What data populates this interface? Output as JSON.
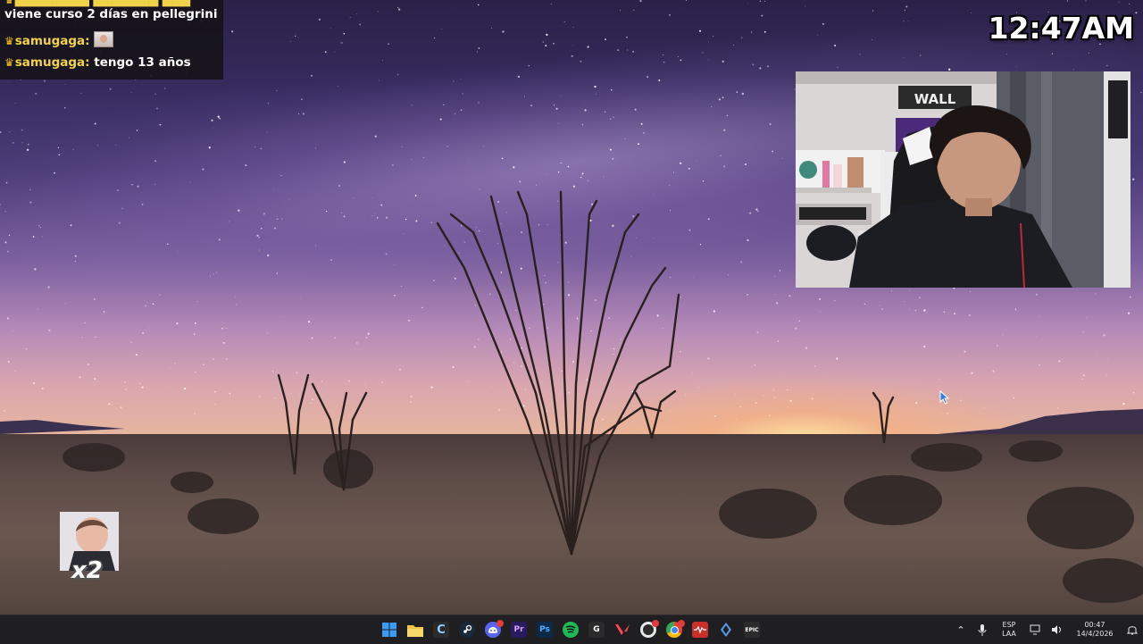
{
  "chat": {
    "messages": [
      {
        "user": "",
        "text": "viene curso 2 días en pellegrini"
      },
      {
        "user": "samugaga:",
        "text": "",
        "emote": "baby-emote"
      },
      {
        "user": "samugaga:",
        "text": "tengo 13 años"
      }
    ]
  },
  "clock": {
    "time": "12:47AM"
  },
  "baby_overlay": {
    "multiplier": "x2"
  },
  "taskbar": {
    "apps": [
      {
        "name": "start",
        "icon": "windows-start-icon",
        "label": "",
        "color": "#3b8ff0"
      },
      {
        "name": "file-explorer",
        "icon": "folder-icon",
        "label": "",
        "color": "#f3c545"
      },
      {
        "name": "ccleaner",
        "icon": "ccleaner-icon",
        "label": "C",
        "color": "#2b2b2b"
      },
      {
        "name": "steam",
        "icon": "steam-icon",
        "label": "",
        "color": "#1b2838"
      },
      {
        "name": "discord",
        "icon": "discord-icon",
        "label": "",
        "color": "#5865f2"
      },
      {
        "name": "premiere-pro",
        "icon": "premiere-icon",
        "label": "Pr",
        "color": "#2a1a5e"
      },
      {
        "name": "photoshop",
        "icon": "photoshop-icon",
        "label": "Ps",
        "color": "#0b2a4a"
      },
      {
        "name": "spotify",
        "icon": "spotify-icon",
        "label": "",
        "color": "#1db954"
      },
      {
        "name": "ghub",
        "icon": "logitech-g-icon",
        "label": "G",
        "color": "#2b2b2b"
      },
      {
        "name": "valorant",
        "icon": "valorant-icon",
        "label": "V",
        "color": "#2b2b2b"
      },
      {
        "name": "obs",
        "icon": "obs-icon",
        "label": "",
        "color": "#2b2b2b"
      },
      {
        "name": "chrome",
        "icon": "chrome-icon",
        "label": "",
        "color": "#e8e8e8"
      },
      {
        "name": "voicemod",
        "icon": "voicemod-icon",
        "label": "",
        "color": "#c9302c"
      },
      {
        "name": "lunar",
        "icon": "diamond-app-icon",
        "label": "",
        "color": "#2b2b2b"
      },
      {
        "name": "epic-games",
        "icon": "epic-games-icon",
        "label": "EPIC",
        "color": "#2b2b2b"
      }
    ],
    "tray": {
      "lang_top": "ESP",
      "lang_bottom": "LAA",
      "time": "00:47",
      "date": "14/4/2026"
    }
  }
}
